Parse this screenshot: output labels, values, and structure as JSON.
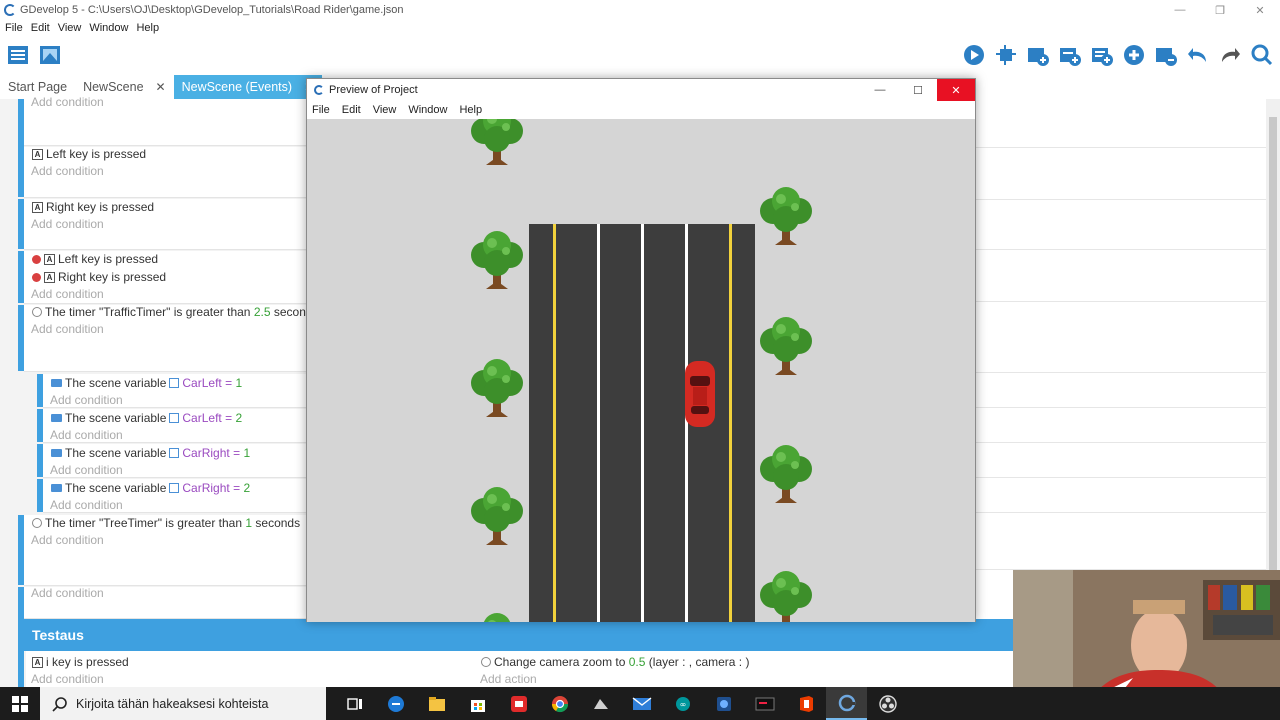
{
  "window": {
    "title": "GDevelop 5 - C:\\Users\\OJ\\Desktop\\GDevelop_Tutorials\\Road Rider\\game.json"
  },
  "menu": [
    "File",
    "Edit",
    "View",
    "Window",
    "Help"
  ],
  "tabs": [
    {
      "label": "Start Page",
      "active": false,
      "closable": false
    },
    {
      "label": "NewScene",
      "active": false,
      "closable": true
    },
    {
      "label": "NewScene (Events)",
      "active": true,
      "closable": true
    }
  ],
  "tab_close_glyph": "✕",
  "events": {
    "add_condition": "Add condition",
    "add_action": "Add action",
    "left_key": {
      "key": "Left",
      "rest": "key is pressed"
    },
    "right_key": {
      "key": "Right",
      "rest": "key is pressed"
    },
    "inv_left": {
      "key": "Left",
      "rest": "key is pressed"
    },
    "inv_right": {
      "key": "Right",
      "rest": "key is pressed"
    },
    "traffic_timer": {
      "prefix": "The timer \"TrafficTimer\" is greater than",
      "value": "2.5",
      "suffix": "second"
    },
    "subs": [
      {
        "prefix": "The scene variable",
        "var": "CarLeft",
        "op": "=",
        "value": "1"
      },
      {
        "prefix": "The scene variable",
        "var": "CarLeft",
        "op": "=",
        "value": "2"
      },
      {
        "prefix": "The scene variable",
        "var": "CarRight",
        "op": "=",
        "value": "1"
      },
      {
        "prefix": "The scene variable",
        "var": "CarRight",
        "op": "=",
        "value": "2"
      }
    ],
    "tree_timer": {
      "prefix": "The timer \"TreeTimer\" is greater than",
      "value": "1",
      "suffix": "seconds"
    },
    "group_title": "Testaus",
    "i_key": {
      "key": "i",
      "rest": "key is pressed"
    },
    "camera_action": {
      "prefix": "Change camera zoom to",
      "value": "0.5",
      "suffix": "(layer : , camera : )"
    }
  },
  "preview": {
    "title": "Preview of Project",
    "menu": [
      "File",
      "Edit",
      "View",
      "Window",
      "Help"
    ]
  },
  "taskbar": {
    "search_placeholder": "Kirjoita tähän hakeaksesi kohteista"
  },
  "colors": {
    "accent": "#3ea0e0",
    "active_tab": "#4ab0e4",
    "close_red": "#e81123",
    "road": "#3d3d3d",
    "lane_yellow": "#f2d23c",
    "car": "#d42a22"
  }
}
